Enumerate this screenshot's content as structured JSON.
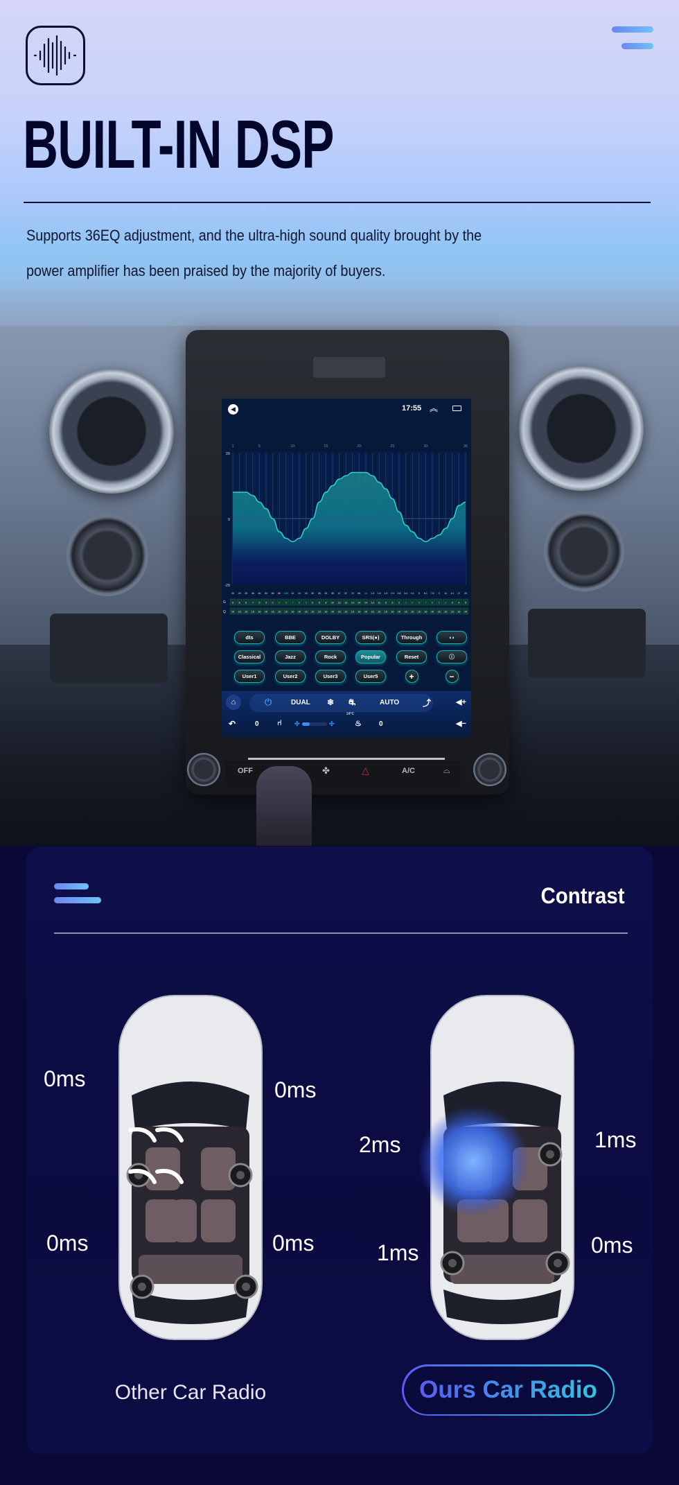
{
  "header": {
    "title": "BUILT-IN DSP",
    "description_line1": "Supports 36EQ adjustment, and the ultra-high sound quality brought by the",
    "description_line2": "power amplifier has been praised by the majority of buyers.",
    "logo_icon": "sound-wave-icon",
    "menu_icon": "menu-icon"
  },
  "head_unit": {
    "status": {
      "time": "17:55",
      "back_icon": "back-icon",
      "up_icon": "double-chevron-up-icon",
      "window_icon": "recent-apps-icon"
    },
    "presets_row1": [
      "dts",
      "BBE",
      "DOLBY",
      "SRS(●)",
      "Through",
      "◖◗"
    ],
    "presets_row2": [
      "Classical",
      "Jazz",
      "Rock",
      "Popular",
      "Reset",
      "ⓘ"
    ],
    "presets_row3": [
      "User1",
      "User2",
      "User3",
      "User5",
      "+",
      "−"
    ],
    "selected_preset": "Popular",
    "climate": {
      "dual": "DUAL",
      "auto": "AUTO",
      "temp": "24°C",
      "left_seat": "0",
      "right_seat": "0",
      "fan_level": 0.3
    },
    "physical": {
      "off": "OFF",
      "ac": "A/C"
    }
  },
  "chart_data": {
    "type": "area",
    "ylim": [
      -20,
      20
    ],
    "yticks": [
      "20",
      "0",
      "-20"
    ],
    "band_ticks": [
      "1",
      "5",
      "10",
      "15",
      "20",
      "25",
      "30",
      "36"
    ],
    "frequencies": [
      "20",
      "24",
      "29",
      "36",
      "45",
      "53",
      "65",
      "80",
      "100",
      "12",
      "14",
      "18",
      "20",
      "26",
      "32",
      "39",
      "47",
      "57",
      "70",
      "85",
      "1k",
      "1.3",
      "1.6",
      "1.9",
      "2.3",
      "2.8",
      "3.4",
      "4.1",
      "5",
      "6.1",
      "7.5",
      "9",
      "11",
      "14",
      "17",
      "20"
    ],
    "gains": [
      8,
      8,
      8,
      7,
      5,
      3,
      0,
      -4,
      -6,
      -7,
      -6,
      -3,
      0,
      5,
      8,
      10,
      12,
      13,
      14,
      14,
      14,
      13,
      11,
      9,
      6,
      2,
      -2,
      -4,
      -6,
      -7,
      -6,
      -5,
      -3,
      0,
      4,
      5
    ],
    "g_label": "G",
    "q_label": "Q",
    "g_values": [
      "8",
      "8",
      "8",
      "7",
      "5",
      "3",
      "0",
      "4",
      "6",
      "7",
      "6",
      "3",
      "0",
      "5",
      "8",
      "10",
      "12",
      "13",
      "14",
      "14",
      "14",
      "13",
      "11",
      "9",
      "6",
      "2",
      "2",
      "4",
      "6",
      "7",
      "6",
      "5",
      "3",
      "0",
      "4",
      "5"
    ],
    "q_value": "16",
    "colors": {
      "line": "#2fd3c8",
      "highlight": "#2ee07a",
      "background": "#06193a"
    }
  },
  "contrast": {
    "title": "Contrast",
    "other": {
      "label": "Other Car Radio",
      "front_left": "0ms",
      "front_right": "0ms",
      "rear_left": "0ms",
      "rear_right": "0ms"
    },
    "ours": {
      "label": "Ours Car Radio",
      "front_left": "2ms",
      "front_right": "1ms",
      "rear_left": "1ms",
      "rear_right": "0ms"
    },
    "colors": {
      "accent_start": "#5a5cf0",
      "accent_end": "#2ec6e0",
      "panel": "#0e0f4a"
    }
  }
}
